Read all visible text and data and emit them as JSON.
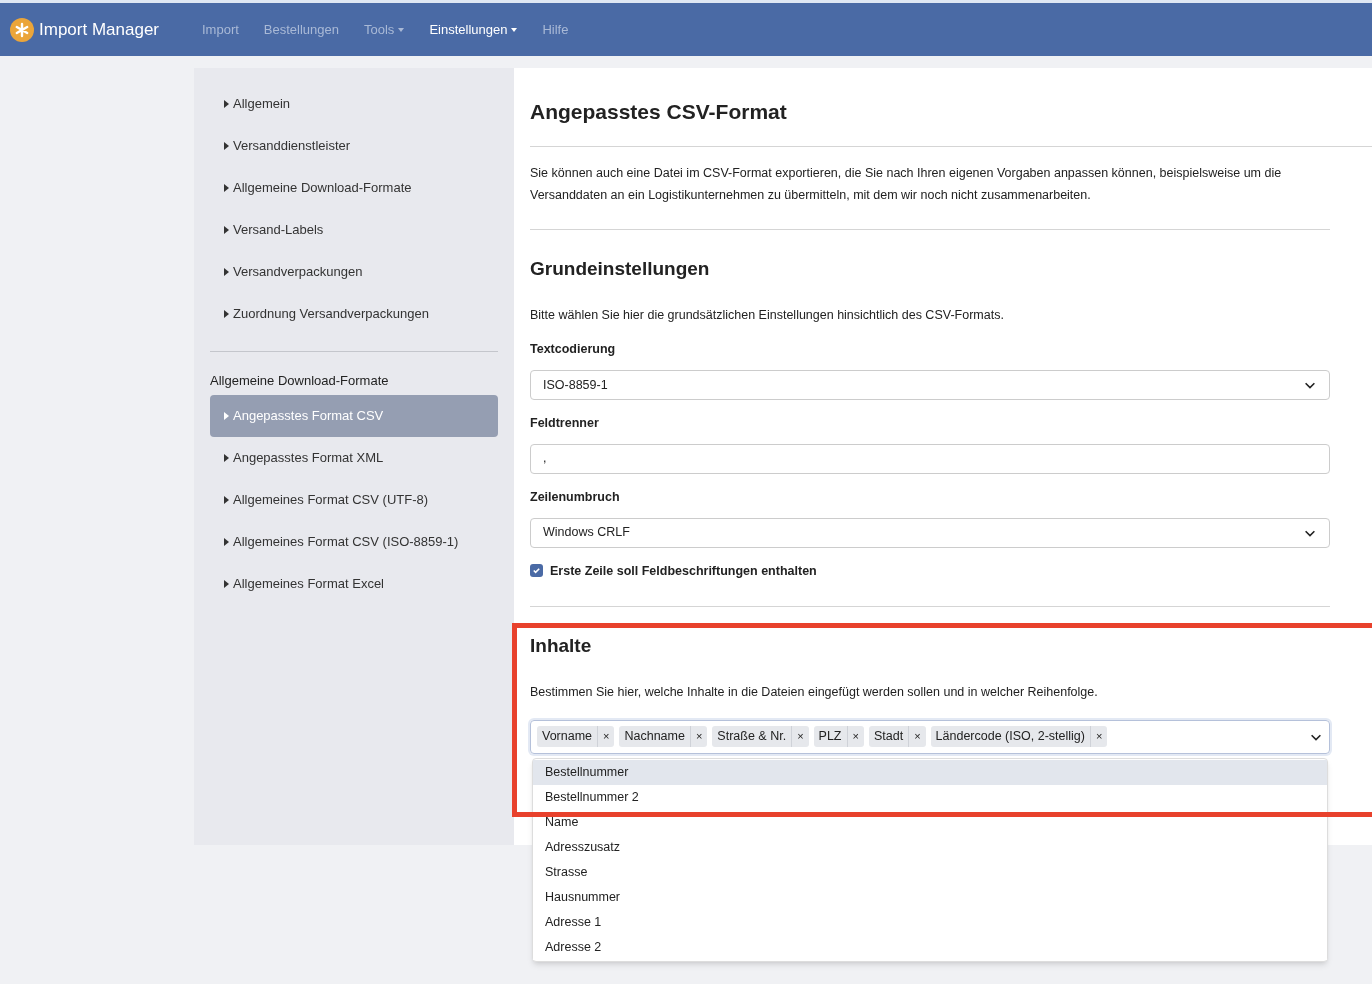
{
  "app": {
    "title": "Import Manager"
  },
  "nav": [
    {
      "label": "Import",
      "selected": false,
      "menu": false
    },
    {
      "label": "Bestellungen",
      "selected": false,
      "menu": false
    },
    {
      "label": "Tools",
      "selected": false,
      "menu": true
    },
    {
      "label": "Einstellungen",
      "selected": true,
      "menu": true
    },
    {
      "label": "Hilfe",
      "selected": false,
      "menu": false
    }
  ],
  "sidebar": {
    "groups": [
      {
        "items": [
          {
            "label": "Allgemein",
            "selected": false
          },
          {
            "label": "Versanddienstleister",
            "selected": false
          },
          {
            "label": "Allgemeine Download-Formate",
            "selected": false
          },
          {
            "label": "Versand-Labels",
            "selected": false
          },
          {
            "label": "Versandverpackungen",
            "selected": false
          },
          {
            "label": "Zuordnung Versandverpackungen",
            "selected": false
          }
        ]
      },
      {
        "heading": "Allgemeine Download-Formate",
        "items": [
          {
            "label": "Angepasstes Format CSV",
            "selected": true
          },
          {
            "label": "Angepasstes Format XML",
            "selected": false
          },
          {
            "label": "Allgemeines Format CSV (UTF-8)",
            "selected": false
          },
          {
            "label": "Allgemeines Format CSV (ISO-8859-1)",
            "selected": false
          },
          {
            "label": "Allgemeines Format Excel",
            "selected": false
          }
        ]
      }
    ]
  },
  "page": {
    "title": "Angepasstes CSV-Format",
    "intro": "Sie können auch eine Datei im CSV-Format exportieren, die Sie nach Ihren eigenen Vorgaben anpassen können, beispielsweise um die Versanddaten an ein Logistikunternehmen zu übermitteln, mit dem wir noch nicht zusammenarbeiten.",
    "basics": {
      "title": "Grundeinstellungen",
      "text": "Bitte wählen Sie hier die grundsätzlichen Einstellungen hinsichtlich des CSV-Formats.",
      "fields": [
        {
          "kind": "select",
          "label": "Textcodierung",
          "value": "ISO-8859-1"
        },
        {
          "kind": "input",
          "label": "Feldtrenner",
          "value": ","
        },
        {
          "kind": "select",
          "label": "Zeilenumbruch",
          "value": "Windows CRLF"
        },
        {
          "kind": "checkbox",
          "label": "Erste Zeile soll Feldbeschriftungen enthalten",
          "checked": true
        }
      ]
    },
    "contents": {
      "title": "Inhalte",
      "highlighted": true,
      "text": "Bestimmen Sie hier, welche Inhalte in die Dateien eingefügt werden sollen und in welcher Reihenfolge.",
      "tags": [
        {
          "label": "Vorname",
          "remove": "×"
        },
        {
          "label": "Nachname",
          "remove": "×"
        },
        {
          "label": "Straße & Nr.",
          "remove": "×"
        },
        {
          "label": "PLZ",
          "remove": "×"
        },
        {
          "label": "Stadt",
          "remove": "×"
        },
        {
          "label": "Ländercode (ISO, 2-stellig)",
          "remove": "×"
        }
      ],
      "options": [
        {
          "label": "Bestellnummer",
          "selected": true
        },
        {
          "label": "Bestellnummer 2",
          "selected": false
        },
        {
          "label": "Name",
          "selected": false
        },
        {
          "label": "Adresszusatz",
          "selected": false
        },
        {
          "label": "Strasse",
          "selected": false
        },
        {
          "label": "Hausnummer",
          "selected": false
        },
        {
          "label": "Adresse 1",
          "selected": false
        },
        {
          "label": "Adresse 2",
          "selected": false
        }
      ]
    }
  }
}
